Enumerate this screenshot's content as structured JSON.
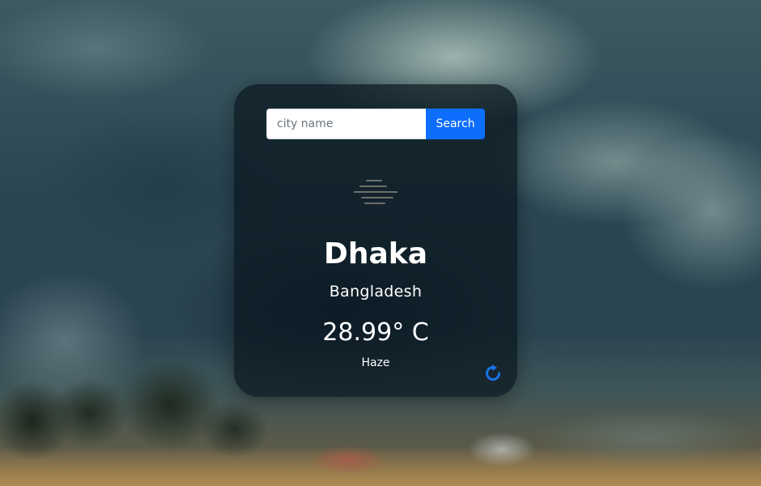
{
  "search": {
    "placeholder": "city name",
    "value": "",
    "button_label": "Search"
  },
  "weather": {
    "icon": "haze-icon",
    "city": "Dhaka",
    "country": "Bangladesh",
    "temperature": "28.99° C",
    "condition": "Haze"
  },
  "actions": {
    "refresh_icon": "refresh-icon"
  },
  "colors": {
    "accent": "#0d6efd",
    "card_background": "rgba(10,22,30,0.72)",
    "text": "#ffffff",
    "icon_gray": "#6b6f6d"
  }
}
